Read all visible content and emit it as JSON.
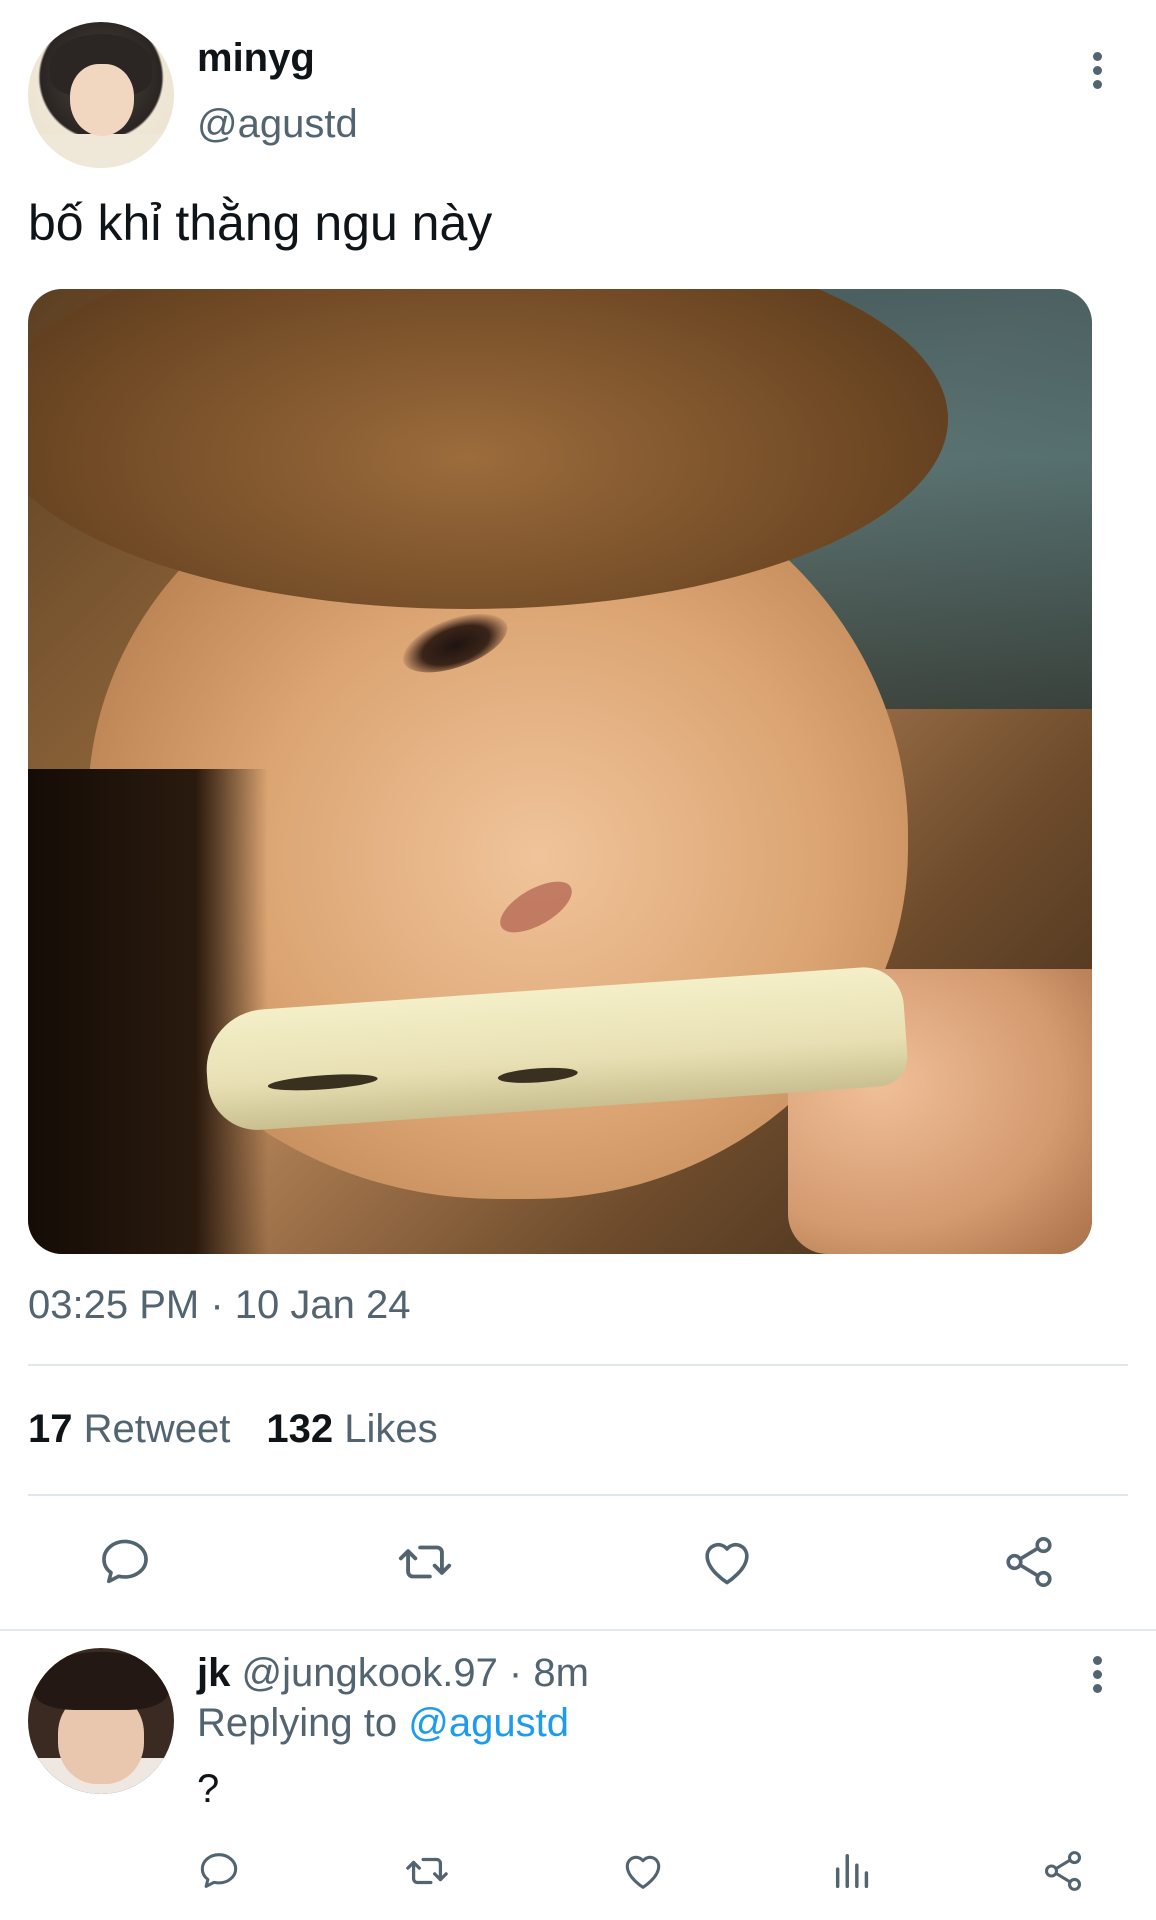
{
  "tweet": {
    "author_name": "minyg",
    "author_handle": "@agustd",
    "text": "bố khỉ thằng ngu này",
    "timestamp": "03:25 PM · 10 Jan 24",
    "retweet_count": "17",
    "retweet_label": "Retweet",
    "like_count": "132",
    "like_label": "Likes",
    "icons": [
      "more-vertical-icon",
      "reply-icon",
      "retweet-icon",
      "like-icon",
      "share-icon"
    ]
  },
  "reply": {
    "author_name": "jk",
    "author_handle": "@jungkook.97",
    "separator": " · ",
    "time_ago": "8m",
    "replying_label": "Replying to ",
    "replying_to": "@agustd",
    "text": "?",
    "icons": [
      "more-vertical-icon",
      "reply-icon",
      "retweet-icon",
      "like-icon",
      "analytics-icon",
      "share-icon"
    ]
  },
  "colors": {
    "text_primary": "#0f1419",
    "text_secondary": "#536471",
    "accent": "#1d9bf0",
    "divider": "#e1e8ed"
  }
}
